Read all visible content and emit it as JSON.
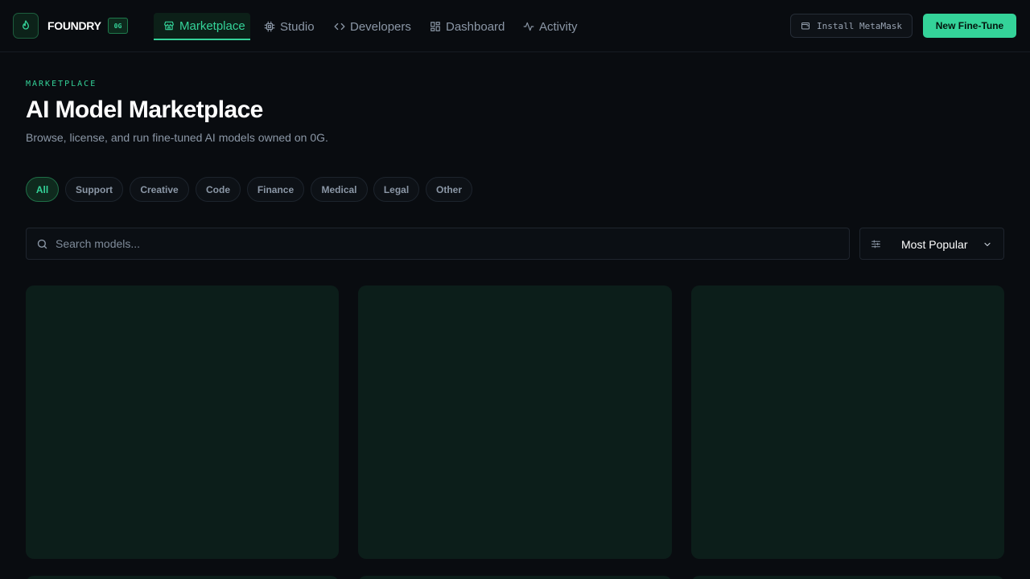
{
  "app": {
    "brand": "FOUNDRY",
    "chain_badge": "0G"
  },
  "nav": {
    "items": [
      {
        "label": "Marketplace",
        "icon": "storefront-icon",
        "active": true
      },
      {
        "label": "Studio",
        "icon": "cpu-chip-icon",
        "active": false
      },
      {
        "label": "Developers",
        "icon": "code-brackets-icon",
        "active": false
      },
      {
        "label": "Dashboard",
        "icon": "grid-dashboard-icon",
        "active": false
      },
      {
        "label": "Activity",
        "icon": "pulse-activity-icon",
        "active": false
      }
    ],
    "install_label": "Install MetaMask",
    "install_icon": "wallet-icon",
    "primary_action": "New Fine-Tune"
  },
  "header": {
    "eyebrow": "MARKETPLACE",
    "title": "AI Model Marketplace",
    "subtitle": "Browse, license, and run fine-tuned AI models owned on 0G."
  },
  "filters": {
    "categories": [
      "All",
      "Support",
      "Creative",
      "Code",
      "Finance",
      "Medical",
      "Legal",
      "Other"
    ],
    "selected": "All"
  },
  "search": {
    "placeholder": "Search models...",
    "value": ""
  },
  "sort": {
    "selected": "Most Popular",
    "icon": "sliders-icon"
  },
  "colors": {
    "accent": "#34d399",
    "background": "#090c10",
    "card_placeholder": "#0c1e1a"
  }
}
